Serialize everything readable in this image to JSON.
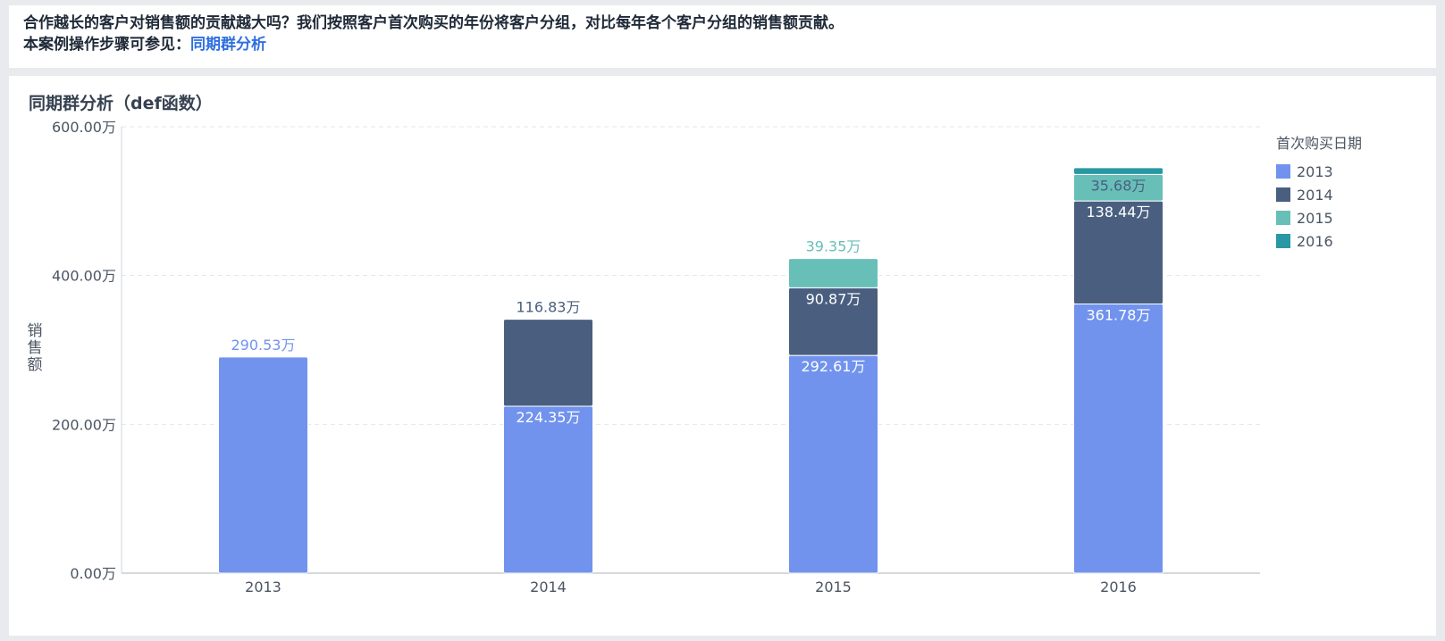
{
  "intro": {
    "line1": "合作越长的客户对销售额的贡献越大吗？我们按照客户首次购买的年份将客户分组，对比每年各个客户分组的销售额贡献。",
    "line2_prefix": "本案例操作步骤可参见：",
    "link_text": "同期群分析"
  },
  "panel": {
    "title": "同期群分析（def函数）"
  },
  "colors": {
    "2013": "#7193ee",
    "2014": "#4a5f80",
    "2015": "#67bfb8",
    "2016": "#2898a3",
    "axis_text": "#4b5563",
    "grid": "#e3e6eb"
  },
  "chart_data": {
    "type": "bar",
    "stacked": true,
    "categories": [
      "2013",
      "2014",
      "2015",
      "2016"
    ],
    "series": [
      {
        "name": "2013",
        "values": [
          290.53,
          224.35,
          292.61,
          361.78
        ],
        "labels": [
          "290.53万",
          "224.35万",
          "292.61万",
          "361.78万"
        ]
      },
      {
        "name": "2014",
        "values": [
          null,
          116.83,
          90.87,
          138.44
        ],
        "labels": [
          "",
          "116.83万",
          "90.87万",
          "138.44万"
        ]
      },
      {
        "name": "2015",
        "values": [
          null,
          null,
          39.35,
          35.68
        ],
        "labels": [
          "",
          "",
          "39.35万",
          "35.68万"
        ]
      },
      {
        "name": "2016",
        "values": [
          null,
          null,
          null,
          9.0
        ],
        "labels": [
          "",
          "",
          "",
          ""
        ]
      }
    ],
    "ylabel": "销售额",
    "xlabel": "",
    "ylim": [
      0,
      600
    ],
    "yticks": [
      0,
      200,
      400,
      600
    ],
    "ytick_labels": [
      "0.00万",
      "200.00万",
      "400.00万",
      "600.00万"
    ],
    "grid": true,
    "legend": {
      "title": "首次购买日期",
      "position": "right",
      "items": [
        "2013",
        "2014",
        "2015",
        "2016"
      ]
    }
  }
}
